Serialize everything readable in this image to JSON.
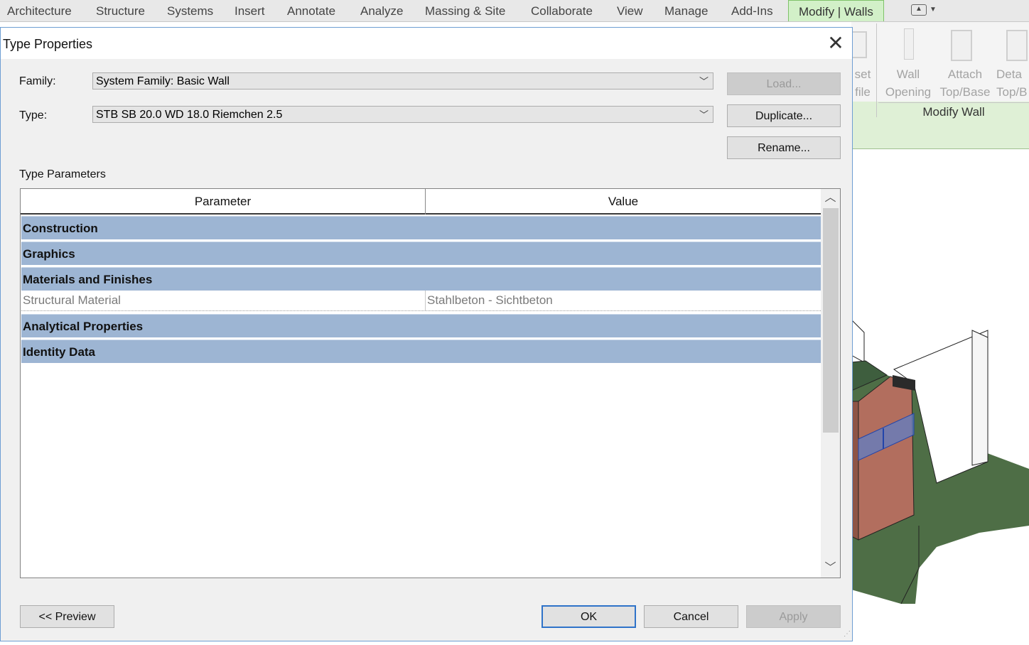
{
  "ribbon": {
    "tabs": [
      "Architecture",
      "Structure",
      "Systems",
      "Insert",
      "Annotate",
      "Analyze",
      "Massing & Site",
      "Collaborate",
      "View",
      "Manage",
      "Add-Ins"
    ],
    "active_tab": "Modify | Walls",
    "buttons": {
      "partial_1": "set",
      "partial_2": "file",
      "wall_opening_1": "Wall",
      "wall_opening_2": "Opening",
      "attach_1": "Attach",
      "attach_2": "Top/Base",
      "detach_1": "Deta",
      "detach_2": "Top/B"
    },
    "panel_label": "Modify Wall"
  },
  "dialog": {
    "title": "Type Properties",
    "family_label": "Family:",
    "family_value": "System Family: Basic Wall",
    "type_label": "Type:",
    "type_value": "STB SB 20.0 WD 18.0 Riemchen 2.5",
    "load_button": "Load...",
    "duplicate_button": "Duplicate...",
    "rename_button": "Rename...",
    "type_parameters_label": "Type Parameters",
    "grid": {
      "col_parameter": "Parameter",
      "col_value": "Value",
      "groups": {
        "construction": "Construction",
        "graphics": "Graphics",
        "materials": "Materials and Finishes",
        "analytical": "Analytical Properties",
        "identity": "Identity Data"
      },
      "rows": [
        {
          "parameter": "Structural Material",
          "value": "Stahlbeton - Sichtbeton"
        }
      ]
    },
    "preview_button": "<< Preview",
    "ok_button": "OK",
    "cancel_button": "Cancel",
    "apply_button": "Apply"
  }
}
